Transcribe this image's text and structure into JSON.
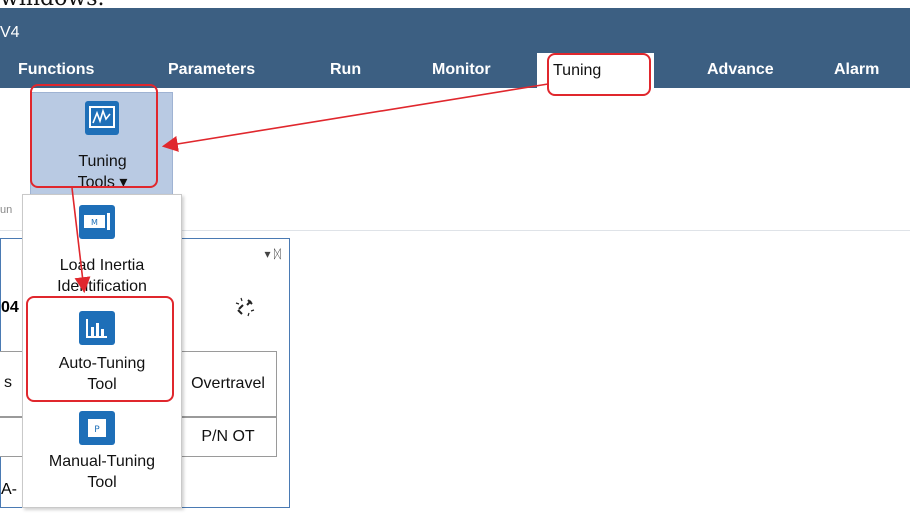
{
  "caption": "windows.",
  "app": {
    "title": "V4"
  },
  "menu": {
    "tabs": [
      {
        "label": "Functions"
      },
      {
        "label": "Parameters"
      },
      {
        "label": "Run"
      },
      {
        "label": "Monitor"
      },
      {
        "label": "Tuning"
      },
      {
        "label": "Advance"
      },
      {
        "label": "Alarm"
      }
    ],
    "active": "Tuning"
  },
  "ribbon": {
    "group_label": "un",
    "tuning_tools": {
      "line1": "Tuning",
      "line2": "Tools ▾"
    }
  },
  "dropdown": {
    "items": [
      {
        "line1": "Load Inertia",
        "line2": "Identification",
        "icon": "load-inertia-icon"
      },
      {
        "line1": "Auto-Tuning",
        "line2": "Tool",
        "icon": "auto-tuning-icon"
      },
      {
        "line1": "Manual-Tuning",
        "line2": "Tool",
        "icon": "manual-tuning-icon"
      }
    ]
  },
  "panel": {
    "pin_glyph": "▾ ᛞ",
    "partial_label": "04",
    "link_icon": "broken-link-icon",
    "col_partial": "s",
    "overtravel": "Overtravel",
    "pn_ot": "P/N OT",
    "row_partial": "A-"
  },
  "colors": {
    "header_bg": "#3c5f82",
    "accent": "#e0272d",
    "button_bg": "#b9cae3",
    "icon_blue": "#1e6fb8"
  }
}
